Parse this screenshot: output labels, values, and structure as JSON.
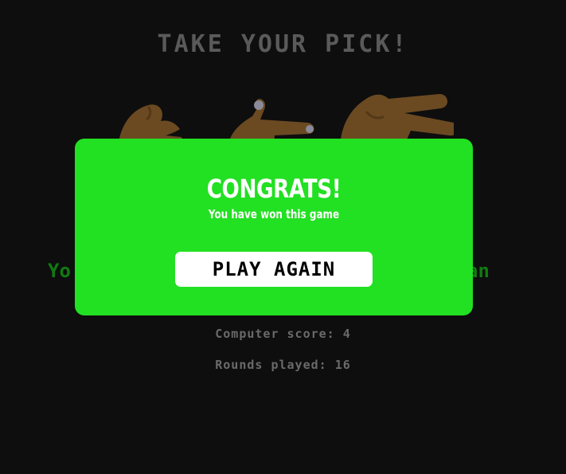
{
  "game": {
    "title": "TAKE YOUR PICK!",
    "choices": [
      {
        "name": "rock",
        "icon": "rock-hand-icon"
      },
      {
        "name": "paper",
        "icon": "paper-hand-icon"
      },
      {
        "name": "scissors",
        "icon": "scissors-hand-icon"
      }
    ],
    "result_left": "Yo",
    "result_right": "an",
    "computer_score": "Computer score: 4",
    "rounds_played": "Rounds played: 16"
  },
  "modal": {
    "title": "CONGRATS!",
    "subtitle": "You have won this game",
    "button_label": "PLAY AGAIN"
  },
  "colors": {
    "background": "#0e0e0e",
    "modal": "#22e022",
    "title_dim": "#5a5a5a",
    "result_green": "#117a11",
    "hand": "#6b4a22"
  }
}
